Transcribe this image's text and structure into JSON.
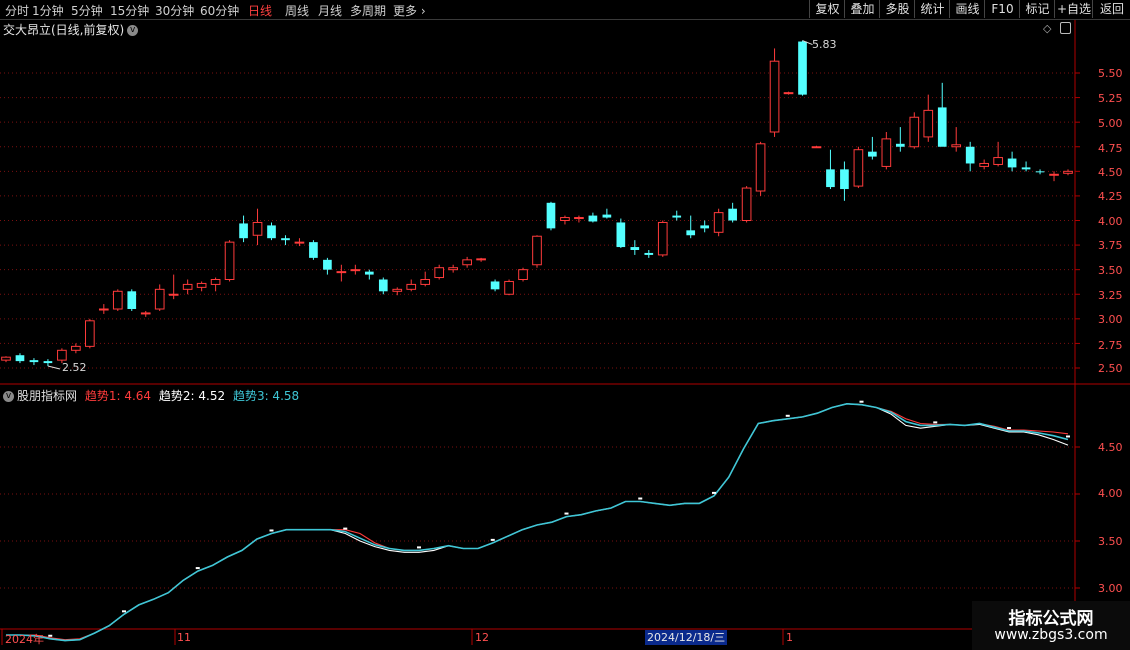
{
  "toolbar": {
    "periods": [
      "分时",
      "1分钟",
      "5分钟",
      "15分钟",
      "30分钟",
      "60分钟",
      "日线",
      "周线",
      "月线",
      "多周期",
      "更多"
    ],
    "active_period": "日线",
    "right_buttons": [
      "复权",
      "叠加",
      "多股",
      "统计",
      "画线",
      "F10",
      "标记",
      "+自选",
      "返回"
    ]
  },
  "main_chart": {
    "title": "交大昂立(日线,前复权)",
    "high_label": "5.83",
    "low_label": "2.52",
    "y_ticks": [
      "5.50",
      "5.25",
      "5.00",
      "4.75",
      "4.50",
      "4.25",
      "4.00",
      "3.75",
      "3.50",
      "3.25",
      "3.00",
      "2.75",
      "2.50"
    ],
    "colors": {
      "up": "#ff3b3b",
      "down": "#54ffff",
      "grid": "#7a1010",
      "frame": "#b00000",
      "background": "#000000"
    }
  },
  "indicator": {
    "name": "股朋指标网",
    "items": [
      {
        "label": "趋势1: 4.64",
        "color": "#ff3b3b"
      },
      {
        "label": "趋势2: 4.52",
        "color": "#ffffff"
      },
      {
        "label": "趋势3: 4.58",
        "color": "#3ec6d6"
      }
    ],
    "y_ticks": [
      "4.50",
      "4.00",
      "3.50",
      "3.00"
    ]
  },
  "x_axis": {
    "labels": [
      "2024年",
      "11",
      "12",
      "1"
    ],
    "selected_date": "2024/12/18/三"
  },
  "watermark": {
    "line1": "指标公式网",
    "line2": "www.zbgs3.com"
  },
  "chart_data": {
    "type": "candlestick",
    "columns": [
      "open",
      "high",
      "low",
      "close"
    ],
    "candles": [
      [
        2.58,
        2.62,
        2.56,
        2.61
      ],
      [
        2.63,
        2.65,
        2.55,
        2.57
      ],
      [
        2.58,
        2.6,
        2.53,
        2.56
      ],
      [
        2.57,
        2.59,
        2.52,
        2.55
      ],
      [
        2.58,
        2.7,
        2.55,
        2.68
      ],
      [
        2.68,
        2.75,
        2.65,
        2.72
      ],
      [
        2.72,
        3.0,
        2.7,
        2.98
      ],
      [
        3.1,
        3.15,
        3.05,
        3.1
      ],
      [
        3.1,
        3.3,
        3.08,
        3.28
      ],
      [
        3.28,
        3.3,
        3.08,
        3.1
      ],
      [
        3.05,
        3.08,
        3.02,
        3.06
      ],
      [
        3.1,
        3.35,
        3.08,
        3.3
      ],
      [
        3.25,
        3.45,
        3.2,
        3.25
      ],
      [
        3.3,
        3.4,
        3.25,
        3.35
      ],
      [
        3.32,
        3.38,
        3.28,
        3.36
      ],
      [
        3.35,
        3.42,
        3.28,
        3.4
      ],
      [
        3.4,
        3.8,
        3.38,
        3.78
      ],
      [
        3.97,
        4.05,
        3.78,
        3.82
      ],
      [
        3.85,
        4.12,
        3.75,
        3.98
      ],
      [
        3.95,
        3.98,
        3.8,
        3.82
      ],
      [
        3.82,
        3.85,
        3.75,
        3.8
      ],
      [
        3.78,
        3.82,
        3.74,
        3.78
      ],
      [
        3.78,
        3.8,
        3.6,
        3.62
      ],
      [
        3.6,
        3.62,
        3.45,
        3.5
      ],
      [
        3.48,
        3.55,
        3.38,
        3.48
      ],
      [
        3.5,
        3.55,
        3.45,
        3.5
      ],
      [
        3.48,
        3.5,
        3.4,
        3.45
      ],
      [
        3.4,
        3.42,
        3.25,
        3.28
      ],
      [
        3.28,
        3.32,
        3.24,
        3.3
      ],
      [
        3.3,
        3.4,
        3.28,
        3.35
      ],
      [
        3.35,
        3.48,
        3.33,
        3.4
      ],
      [
        3.42,
        3.55,
        3.4,
        3.52
      ],
      [
        3.5,
        3.55,
        3.47,
        3.52
      ],
      [
        3.55,
        3.63,
        3.52,
        3.6
      ],
      [
        3.6,
        3.62,
        3.58,
        3.61
      ],
      [
        3.38,
        3.4,
        3.28,
        3.3
      ],
      [
        3.25,
        3.4,
        3.24,
        3.38
      ],
      [
        3.4,
        3.52,
        3.38,
        3.5
      ],
      [
        3.55,
        3.85,
        3.52,
        3.84
      ],
      [
        4.18,
        4.19,
        3.9,
        3.92
      ],
      [
        4.0,
        4.05,
        3.96,
        4.03
      ],
      [
        4.02,
        4.05,
        3.98,
        4.03
      ],
      [
        4.05,
        4.08,
        3.98,
        3.99
      ],
      [
        4.06,
        4.12,
        4.02,
        4.03
      ],
      [
        3.98,
        4.02,
        3.72,
        3.73
      ],
      [
        3.73,
        3.8,
        3.65,
        3.7
      ],
      [
        3.67,
        3.7,
        3.62,
        3.65
      ],
      [
        3.65,
        4.0,
        3.63,
        3.98
      ],
      [
        4.05,
        4.1,
        4.0,
        4.03
      ],
      [
        3.9,
        4.05,
        3.82,
        3.85
      ],
      [
        3.95,
        4.0,
        3.88,
        3.92
      ],
      [
        3.88,
        4.12,
        3.84,
        4.08
      ],
      [
        4.12,
        4.18,
        3.98,
        4.0
      ],
      [
        4.0,
        4.35,
        3.98,
        4.33
      ],
      [
        4.3,
        4.8,
        4.25,
        4.78
      ],
      [
        4.9,
        5.75,
        4.85,
        5.62
      ],
      [
        5.3,
        5.31,
        5.28,
        5.3
      ],
      [
        5.82,
        5.83,
        5.27,
        5.28
      ],
      [
        4.75,
        4.76,
        4.74,
        4.75
      ],
      [
        4.52,
        4.72,
        4.32,
        4.34
      ],
      [
        4.52,
        4.6,
        4.2,
        4.32
      ],
      [
        4.35,
        4.75,
        4.33,
        4.72
      ],
      [
        4.7,
        4.85,
        4.62,
        4.65
      ],
      [
        4.55,
        4.9,
        4.52,
        4.83
      ],
      [
        4.78,
        4.95,
        4.7,
        4.75
      ],
      [
        4.75,
        5.1,
        4.73,
        5.05
      ],
      [
        4.85,
        5.28,
        4.8,
        5.12
      ],
      [
        5.15,
        5.4,
        4.9,
        4.75
      ],
      [
        4.75,
        4.95,
        4.7,
        4.77
      ],
      [
        4.75,
        4.8,
        4.5,
        4.58
      ],
      [
        4.55,
        4.62,
        4.52,
        4.58
      ],
      [
        4.57,
        4.8,
        4.55,
        4.64
      ],
      [
        4.63,
        4.7,
        4.5,
        4.54
      ],
      [
        4.54,
        4.6,
        4.5,
        4.52
      ],
      [
        4.5,
        4.52,
        4.47,
        4.49
      ],
      [
        4.46,
        4.5,
        4.4,
        4.47
      ],
      [
        4.48,
        4.52,
        4.46,
        4.5
      ]
    ],
    "high": 5.83,
    "low": 2.52,
    "ylim": [
      2.4,
      5.85
    ],
    "indicator_series": [
      {
        "name": "趋势1",
        "color": "#ff3b3b",
        "values": [
          2.5,
          2.5,
          2.5,
          2.47,
          2.45,
          2.46,
          2.52,
          2.6,
          2.72,
          2.82,
          2.88,
          2.95,
          3.08,
          3.18,
          3.24,
          3.33,
          3.4,
          3.52,
          3.58,
          3.62,
          3.62,
          3.62,
          3.62,
          3.62,
          3.58,
          3.48,
          3.42,
          3.4,
          3.4,
          3.42,
          3.45,
          3.42,
          3.42,
          3.48,
          3.55,
          3.62,
          3.67,
          3.7,
          3.76,
          3.78,
          3.82,
          3.85,
          3.92,
          3.92,
          3.9,
          3.88,
          3.9,
          3.9,
          3.98,
          4.18,
          4.48,
          4.75,
          4.78,
          4.8,
          4.82,
          4.86,
          4.92,
          4.96,
          4.95,
          4.92,
          4.88,
          4.8,
          4.75,
          4.74,
          4.74,
          4.73,
          4.75,
          4.72,
          4.68,
          4.68,
          4.67,
          4.66,
          4.64
        ]
      },
      {
        "name": "趋势2",
        "color": "#ffffff",
        "values": [
          2.5,
          2.5,
          2.49,
          2.46,
          2.44,
          2.45,
          2.52,
          2.6,
          2.72,
          2.82,
          2.88,
          2.95,
          3.08,
          3.18,
          3.24,
          3.33,
          3.4,
          3.52,
          3.58,
          3.62,
          3.62,
          3.62,
          3.62,
          3.58,
          3.5,
          3.44,
          3.4,
          3.38,
          3.38,
          3.4,
          3.45,
          3.42,
          3.42,
          3.48,
          3.55,
          3.62,
          3.67,
          3.7,
          3.76,
          3.78,
          3.82,
          3.85,
          3.92,
          3.92,
          3.9,
          3.88,
          3.9,
          3.9,
          3.98,
          4.18,
          4.48,
          4.75,
          4.78,
          4.8,
          4.82,
          4.86,
          4.92,
          4.96,
          4.95,
          4.92,
          4.85,
          4.73,
          4.7,
          4.72,
          4.74,
          4.73,
          4.74,
          4.7,
          4.66,
          4.66,
          4.63,
          4.58,
          4.52
        ]
      },
      {
        "name": "趋势3",
        "color": "#3ec6d6",
        "values": [
          2.5,
          2.5,
          2.49,
          2.46,
          2.44,
          2.45,
          2.52,
          2.6,
          2.72,
          2.82,
          2.88,
          2.95,
          3.08,
          3.18,
          3.24,
          3.33,
          3.4,
          3.52,
          3.58,
          3.62,
          3.62,
          3.62,
          3.62,
          3.6,
          3.53,
          3.46,
          3.42,
          3.4,
          3.4,
          3.42,
          3.45,
          3.42,
          3.42,
          3.48,
          3.55,
          3.62,
          3.67,
          3.7,
          3.76,
          3.78,
          3.82,
          3.85,
          3.92,
          3.92,
          3.9,
          3.88,
          3.9,
          3.9,
          3.98,
          4.18,
          4.48,
          4.75,
          4.78,
          4.8,
          4.82,
          4.86,
          4.92,
          4.96,
          4.95,
          4.92,
          4.87,
          4.77,
          4.73,
          4.73,
          4.74,
          4.73,
          4.75,
          4.71,
          4.67,
          4.67,
          4.65,
          4.62,
          4.58
        ]
      }
    ],
    "indicator_ylim": [
      2.7,
      5.05
    ]
  }
}
